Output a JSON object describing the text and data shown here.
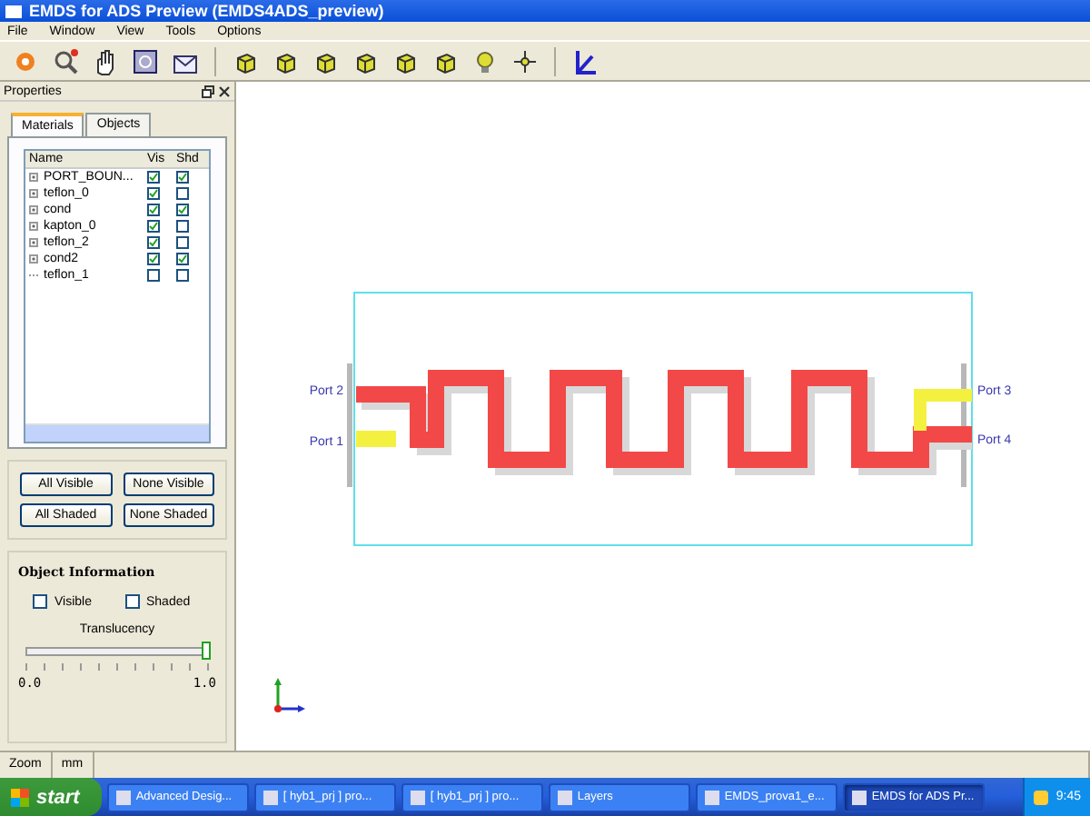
{
  "window": {
    "title": "EMDS for ADS Preview (EMDS4ADS_preview)"
  },
  "menu": [
    "File",
    "Window",
    "View",
    "Tools",
    "Options"
  ],
  "properties_panel": {
    "title": "Properties",
    "tabs": [
      {
        "label": "Materials",
        "selected": true
      },
      {
        "label": "Objects",
        "selected": false
      }
    ],
    "columns": [
      "Name",
      "Vis",
      "Shd"
    ],
    "materials": [
      {
        "name": "PORT_BOUN...",
        "expandable": true,
        "visible": true,
        "shaded": true
      },
      {
        "name": "teflon_0",
        "expandable": true,
        "visible": true,
        "shaded": false
      },
      {
        "name": "cond",
        "expandable": true,
        "visible": true,
        "shaded": true
      },
      {
        "name": "kapton_0",
        "expandable": true,
        "visible": true,
        "shaded": false
      },
      {
        "name": "teflon_2",
        "expandable": true,
        "visible": true,
        "shaded": false
      },
      {
        "name": "cond2",
        "expandable": true,
        "visible": true,
        "shaded": true
      },
      {
        "name": "teflon_1",
        "expandable": false,
        "visible": false,
        "shaded": false
      }
    ],
    "buttons": [
      "All Visible",
      "None Visible",
      "All Shaded",
      "None Shaded"
    ],
    "object_information": {
      "title": "Object Information",
      "checkboxes": [
        {
          "label": "Visible",
          "checked": false
        },
        {
          "label": "Shaded",
          "checked": false
        }
      ],
      "slider": {
        "label": "Translucency",
        "level": 1.0,
        "min_label": "0.0",
        "max_label": "1.0"
      }
    }
  },
  "canvas": {
    "ports": [
      {
        "label": "Port 2"
      },
      {
        "label": "Port 1"
      },
      {
        "label": "Port 3"
      },
      {
        "label": "Port 4"
      }
    ]
  },
  "status_bar": [
    "Zoom",
    "mm"
  ],
  "taskbar": {
    "start": "start",
    "items": [
      {
        "label": "Advanced Desig...",
        "selected": false
      },
      {
        "label": "[ hyb1_prj ] pro...",
        "selected": false
      },
      {
        "label": "[ hyb1_prj ] pro...",
        "selected": false
      },
      {
        "label": "Layers",
        "selected": false
      },
      {
        "label": "EMDS_prova1_e...",
        "selected": false
      },
      {
        "label": "EMDS for ADS Pr...",
        "selected": true
      }
    ],
    "clock": "9:45"
  }
}
